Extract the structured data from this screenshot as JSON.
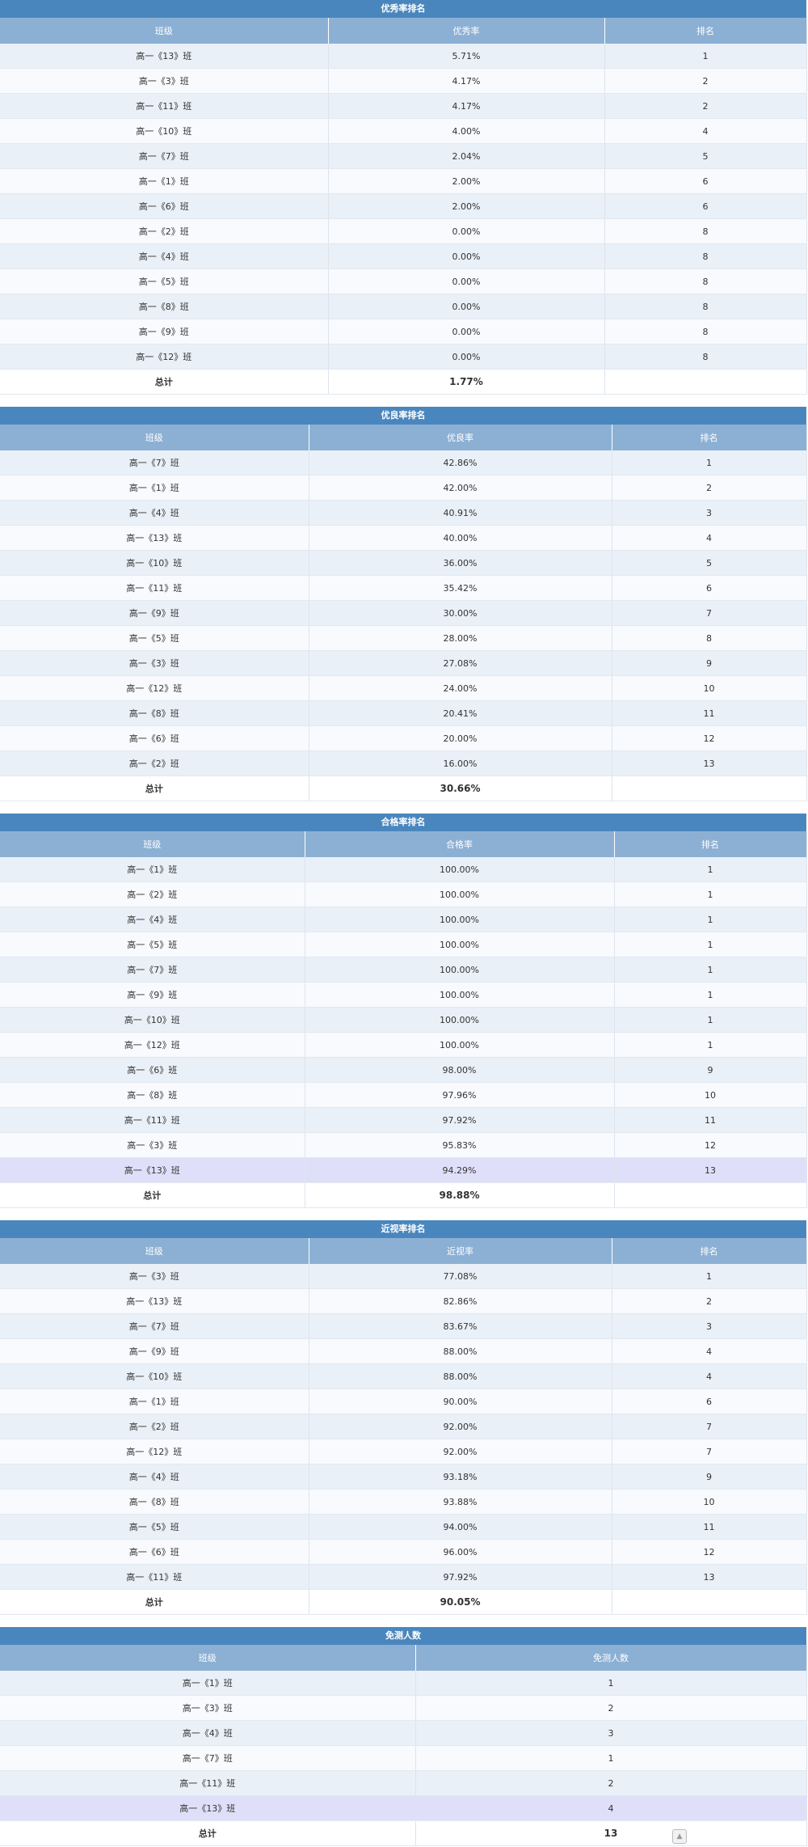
{
  "sections": [
    {
      "title": "优秀率排名",
      "headers": [
        "班级",
        "优秀率",
        "排名"
      ],
      "rows": [
        [
          "高一《13》班",
          "5.71%",
          "1"
        ],
        [
          "高一《3》班",
          "4.17%",
          "2"
        ],
        [
          "高一《11》班",
          "4.17%",
          "2"
        ],
        [
          "高一《10》班",
          "4.00%",
          "4"
        ],
        [
          "高一《7》班",
          "2.04%",
          "5"
        ],
        [
          "高一《1》班",
          "2.00%",
          "6"
        ],
        [
          "高一《6》班",
          "2.00%",
          "6"
        ],
        [
          "高一《2》班",
          "0.00%",
          "8"
        ],
        [
          "高一《4》班",
          "0.00%",
          "8"
        ],
        [
          "高一《5》班",
          "0.00%",
          "8"
        ],
        [
          "高一《8》班",
          "0.00%",
          "8"
        ],
        [
          "高一《9》班",
          "0.00%",
          "8"
        ],
        [
          "高一《12》班",
          "0.00%",
          "8"
        ]
      ],
      "total": [
        "总计",
        "1.77%",
        ""
      ]
    },
    {
      "title": "优良率排名",
      "headers": [
        "班级",
        "优良率",
        "排名"
      ],
      "rows": [
        [
          "高一《7》班",
          "42.86%",
          "1"
        ],
        [
          "高一《1》班",
          "42.00%",
          "2"
        ],
        [
          "高一《4》班",
          "40.91%",
          "3"
        ],
        [
          "高一《13》班",
          "40.00%",
          "4"
        ],
        [
          "高一《10》班",
          "36.00%",
          "5"
        ],
        [
          "高一《11》班",
          "35.42%",
          "6"
        ],
        [
          "高一《9》班",
          "30.00%",
          "7"
        ],
        [
          "高一《5》班",
          "28.00%",
          "8"
        ],
        [
          "高一《3》班",
          "27.08%",
          "9"
        ],
        [
          "高一《12》班",
          "24.00%",
          "10"
        ],
        [
          "高一《8》班",
          "20.41%",
          "11"
        ],
        [
          "高一《6》班",
          "20.00%",
          "12"
        ],
        [
          "高一《2》班",
          "16.00%",
          "13"
        ]
      ],
      "total": [
        "总计",
        "30.66%",
        ""
      ]
    },
    {
      "title": "合格率排名",
      "headers": [
        "班级",
        "合格率",
        "排名"
      ],
      "rows": [
        [
          "高一《1》班",
          "100.00%",
          "1"
        ],
        [
          "高一《2》班",
          "100.00%",
          "1"
        ],
        [
          "高一《4》班",
          "100.00%",
          "1"
        ],
        [
          "高一《5》班",
          "100.00%",
          "1"
        ],
        [
          "高一《7》班",
          "100.00%",
          "1"
        ],
        [
          "高一《9》班",
          "100.00%",
          "1"
        ],
        [
          "高一《10》班",
          "100.00%",
          "1"
        ],
        [
          "高一《12》班",
          "100.00%",
          "1"
        ],
        [
          "高一《6》班",
          "98.00%",
          "9"
        ],
        [
          "高一《8》班",
          "97.96%",
          "10"
        ],
        [
          "高一《11》班",
          "97.92%",
          "11"
        ],
        [
          "高一《3》班",
          "95.83%",
          "12"
        ],
        [
          "高一《13》班",
          "94.29%",
          "13"
        ]
      ],
      "total": [
        "总计",
        "98.88%",
        ""
      ]
    },
    {
      "title": "近视率排名",
      "headers": [
        "班级",
        "近视率",
        "排名"
      ],
      "rows": [
        [
          "高一《3》班",
          "77.08%",
          "1"
        ],
        [
          "高一《13》班",
          "82.86%",
          "2"
        ],
        [
          "高一《7》班",
          "83.67%",
          "3"
        ],
        [
          "高一《9》班",
          "88.00%",
          "4"
        ],
        [
          "高一《10》班",
          "88.00%",
          "4"
        ],
        [
          "高一《1》班",
          "90.00%",
          "6"
        ],
        [
          "高一《2》班",
          "92.00%",
          "7"
        ],
        [
          "高一《12》班",
          "92.00%",
          "7"
        ],
        [
          "高一《4》班",
          "93.18%",
          "9"
        ],
        [
          "高一《8》班",
          "93.88%",
          "10"
        ],
        [
          "高一《5》班",
          "94.00%",
          "11"
        ],
        [
          "高一《6》班",
          "96.00%",
          "12"
        ],
        [
          "高一《11》班",
          "97.92%",
          "13"
        ]
      ],
      "total": [
        "总计",
        "90.05%",
        ""
      ]
    },
    {
      "title": "免测人数",
      "headers": [
        "班级",
        "免测人数"
      ],
      "rows": [
        [
          "高一《1》班",
          "1"
        ],
        [
          "高一《3》班",
          "2"
        ],
        [
          "高一《4》班",
          "3"
        ],
        [
          "高一《7》班",
          "1"
        ],
        [
          "高一《11》班",
          "2"
        ],
        [
          "高一《13》班",
          "4"
        ]
      ],
      "total": [
        "总计",
        "13"
      ]
    }
  ],
  "colors": {
    "title_bar": "#4a86be",
    "header_row": "#8cb0d4",
    "row_alt_a": "#e9f0f8",
    "row_alt_b": "#f8fafd",
    "row_highlight": "#e0dff9"
  },
  "scroll_top_icon": "back-to-top-icon"
}
